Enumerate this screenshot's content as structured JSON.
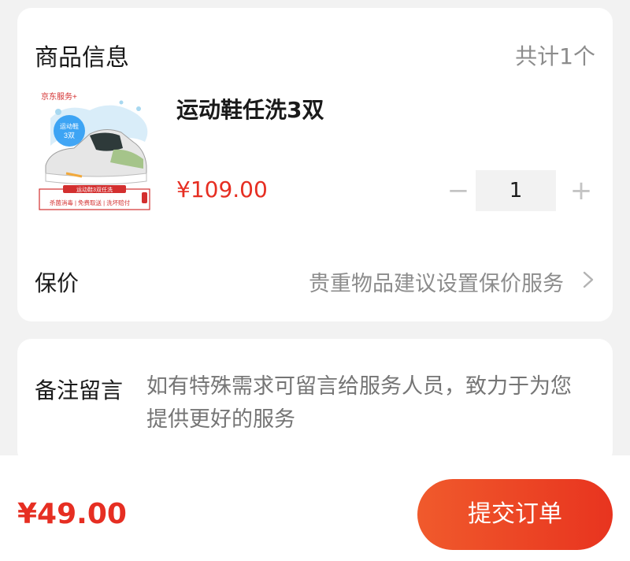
{
  "product_section": {
    "title": "商品信息",
    "total_count": "共计1个",
    "item": {
      "name": "运动鞋任洗3双",
      "price": "¥109.00",
      "quantity": "1",
      "minus_symbol": "−",
      "plus_symbol": "+",
      "image": {
        "brand_text": "京东服务+",
        "badge_text_1": "运动鞋",
        "badge_text_2": "3双",
        "banner_title": "运动鞋3双任洗",
        "banner_tags": "杀菌消毒 | 免费取送 | 洗坏赔付"
      }
    },
    "insurance": {
      "label": "保价",
      "hint": "贵重物品建议设置保价服务"
    }
  },
  "remark_section": {
    "label": "备注留言",
    "placeholder": "如有特殊需求可留言给服务人员，致力于为您提供更好的服务"
  },
  "bottom_bar": {
    "amount": "¥49.00",
    "submit_label": "提交订单"
  },
  "colors": {
    "accent": "#e62e22",
    "submit_gradient_start": "#f05a2c",
    "submit_gradient_end": "#e8341f",
    "hint_text": "#8c8c8c",
    "background": "#f2f2f2"
  }
}
